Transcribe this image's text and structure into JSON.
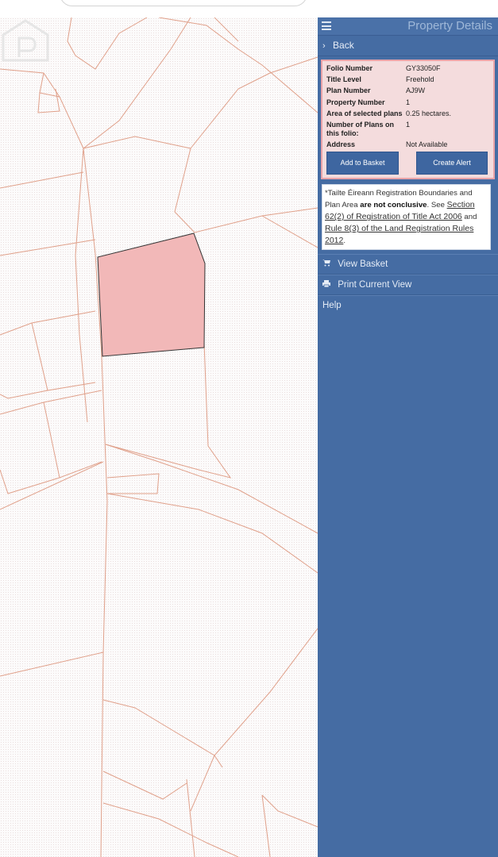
{
  "panel": {
    "title": "Property Details",
    "back_label": "Back",
    "details": [
      {
        "label": "Folio Number",
        "value": "GY33050F"
      },
      {
        "label": "Title Level",
        "value": "Freehold"
      },
      {
        "label": "Plan Number",
        "value": "AJ9W"
      },
      {
        "label": "Property Number",
        "value": "1"
      },
      {
        "label": "Area of selected plans",
        "value": "0.25 hectares."
      },
      {
        "label": "Number of Plans on this folio:",
        "value": "1"
      },
      {
        "label": "Address",
        "value": "Not Available"
      }
    ],
    "add_basket_label": "Add to Basket",
    "create_alert_label": "Create Alert",
    "disclaimer": {
      "star_text": "*Tailte Éireann Registration Boundaries and Plan Area ",
      "bold_text": "are not conclusive",
      "see_text": ". See ",
      "link1": "Section 62(2) of Registration of Title Act 2006",
      "and_text": " and ",
      "link2": "Rule 8(3) of the Land Registration Rules 2012",
      "end_text": "."
    },
    "menu": {
      "view_basket": "View Basket",
      "print_view": "Print Current View",
      "help": "Help"
    }
  },
  "colors": {
    "panel_bg": "#456ca3",
    "selected_parcel": "#f2b8b8",
    "boundary_line": "#e0a08a",
    "details_bg": "#f4dcdd"
  },
  "icons": {
    "menu": "hamburger-icon",
    "back": "chevron-right-icon",
    "basket": "cart-icon",
    "print": "printer-icon"
  }
}
